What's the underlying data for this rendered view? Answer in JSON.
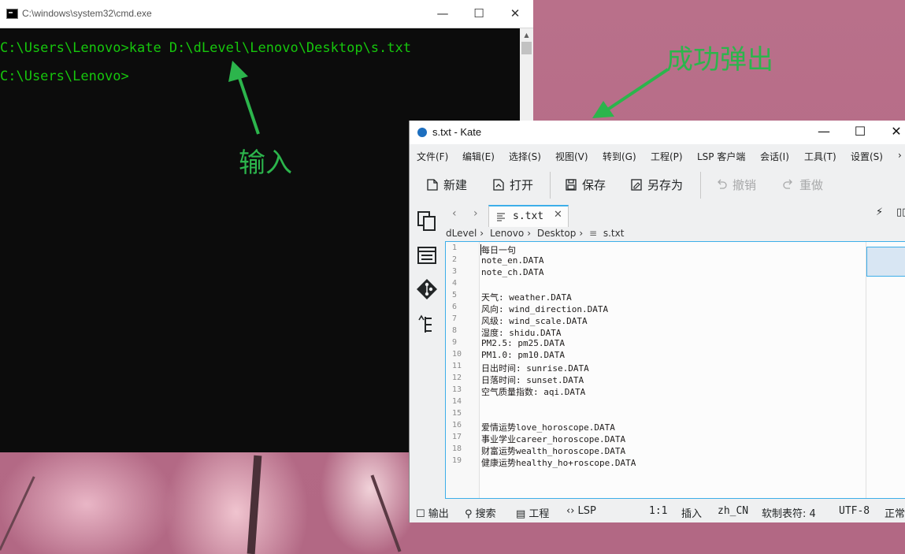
{
  "cmd": {
    "title": "C:\\windows\\system32\\cmd.exe",
    "lines": [
      "C:\\Users\\Lenovo>kate D:\\dLevel\\Lenovo\\Desktop\\s.txt",
      "C:\\Users\\Lenovo>"
    ],
    "minimize": "—",
    "maximize": "☐",
    "close": "✕"
  },
  "annotations": {
    "input_label": "输入",
    "popup_label": "成功弹出",
    "arrow_color": "#2cb54c"
  },
  "kate": {
    "title": "s.txt  - Kate",
    "minimize": "—",
    "maximize": "☐",
    "close": "✕",
    "menu": [
      "文件(F)",
      "编辑(E)",
      "选择(S)",
      "视图(V)",
      "转到(G)",
      "工程(P)",
      "LSP 客户端",
      "会话(I)",
      "工具(T)",
      "设置(S)",
      "›"
    ],
    "toolbar": {
      "new": "新建",
      "open": "打开",
      "save": "保存",
      "save_as": "另存为",
      "undo": "撤销",
      "redo": "重做"
    },
    "tab": {
      "label": "s.txt",
      "close": "✕"
    },
    "breadcrumb": [
      "dLevel",
      "Lenovo",
      "Desktop",
      "s.txt"
    ],
    "lines": [
      "每日一句",
      "note_en.DATA",
      "note_ch.DATA",
      "",
      "天气: weather.DATA",
      "风向: wind_direction.DATA",
      "风级: wind_scale.DATA",
      "湿度: shidu.DATA",
      "PM2.5: pm25.DATA",
      "PM1.0: pm10.DATA",
      "日出时间: sunrise.DATA",
      "日落时间: sunset.DATA",
      "空气质量指数: aqi.DATA",
      "",
      "",
      "爱情运势love_horoscope.DATA",
      "事业学业career_horoscope.DATA",
      "财富运势wealth_horoscope.DATA",
      "健康运势healthy_ho+roscope.DATA"
    ],
    "status": {
      "output": "输出",
      "search": "搜索",
      "project": "工程",
      "lsp": "LSP",
      "position": "1:1",
      "mode": "插入",
      "lang": "zh_CN",
      "indent": "软制表符: 4",
      "encoding": "UTF-8",
      "eol": "正常"
    }
  }
}
